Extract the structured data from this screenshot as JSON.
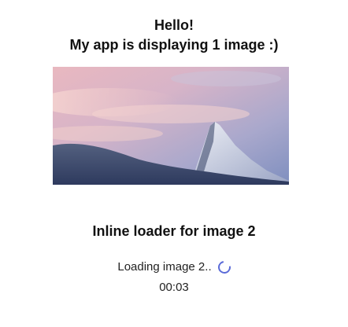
{
  "header": {
    "greeting": "Hello!",
    "subtitle": "My app is displaying 1 image :)"
  },
  "image1": {
    "description": "mountain-landscape-photo"
  },
  "section2": {
    "title": "Inline loader for image 2",
    "loading_text": "Loading image 2..",
    "spinner_color": "#5b6bd8",
    "elapsed": "00:03"
  },
  "colors": {
    "text": "#111111",
    "spinner": "#5b6bd8"
  }
}
